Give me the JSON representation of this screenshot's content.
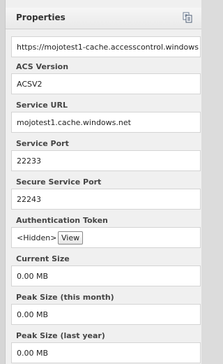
{
  "header": {
    "title": "Properties",
    "expand_icon": "chevron-right-icon",
    "copy_icon": "copy-icon"
  },
  "fields": {
    "first": {
      "value": "https://mojotest1-cache.accesscontrol.windows"
    },
    "acs_version": {
      "label": "ACS Version",
      "value": "ACSV2"
    },
    "service_url": {
      "label": "Service URL",
      "value": "mojotest1.cache.windows.net"
    },
    "service_port": {
      "label": "Service Port",
      "value": "22233"
    },
    "secure_service_port": {
      "label": "Secure Service Port",
      "value": "22243"
    },
    "auth_token": {
      "label": "Authentication Token",
      "value": "<Hidden>",
      "button": "View"
    },
    "current_size": {
      "label": "Current Size",
      "value": "0.00 MB"
    },
    "peak_month": {
      "label": "Peak Size (this month)",
      "value": "0.00 MB"
    },
    "peak_year": {
      "label": "Peak Size (last year)",
      "value": "0.00 MB"
    }
  }
}
